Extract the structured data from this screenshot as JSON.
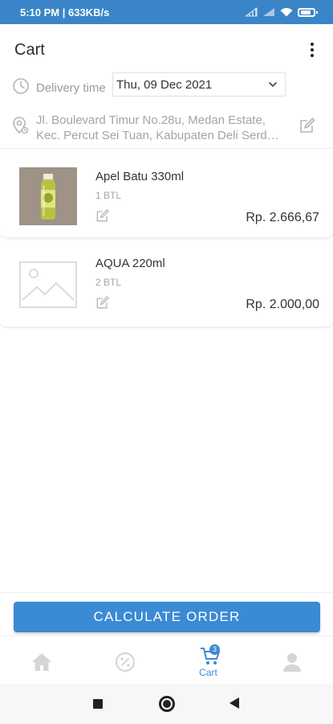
{
  "status_bar": {
    "time_speed": "5:10 PM | 633KB/s",
    "icons": [
      "signal-icon",
      "signal-icon",
      "wifi-icon",
      "battery-icon"
    ]
  },
  "header": {
    "title": "Cart",
    "menu_icon": "more-vertical-icon"
  },
  "delivery": {
    "label": "Delivery time",
    "selected_date": "Thu, 09 Dec 2021",
    "icon": "clock-icon"
  },
  "address": {
    "line1": "Jl. Boulevard Timur No.28u, Medan Estate,",
    "line2": "Kec. Percut Sei Tuan, Kabupaten Deli Serdan...",
    "icon": "location-pin-icon",
    "edit_icon": "edit-icon"
  },
  "cart_items": [
    {
      "name": "Apel Batu 330ml",
      "qty": "1 BTL",
      "price": "Rp. 2.666,67",
      "image": "bottle-image"
    },
    {
      "name": "AQUA 220ml",
      "qty": "2 BTL",
      "price": "Rp. 2.000,00",
      "image": "image-placeholder-icon"
    }
  ],
  "actions": {
    "calculate_label": "CALCULATE ORDER"
  },
  "bottom_nav": {
    "items": [
      {
        "icon": "home-icon",
        "label": ""
      },
      {
        "icon": "promo-icon",
        "label": ""
      },
      {
        "icon": "cart-icon",
        "label": "Cart",
        "badge": "3"
      },
      {
        "icon": "profile-icon",
        "label": ""
      }
    ]
  },
  "colors": {
    "primary": "#3a8ad4",
    "status_bar": "#3a85c7",
    "inactive_icon": "#d6d6d6"
  }
}
